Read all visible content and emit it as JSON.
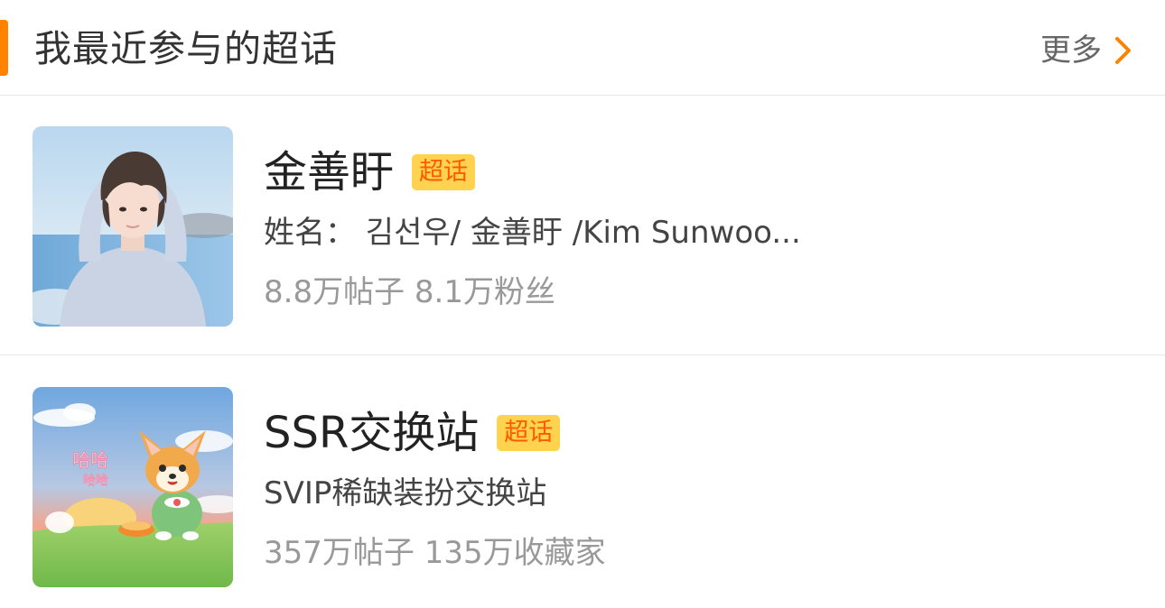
{
  "section": {
    "title": "我最近参与的超话",
    "more_label": "更多",
    "accent_color": "#ff8200"
  },
  "items": [
    {
      "title": "金善盱",
      "badge": "超话",
      "description": "姓名： 김선우/ 金善盱 /Kim Sunwoo...",
      "stats": "8.8万帖子 8.1万粉丝",
      "thumbnail": "person-photo-icon"
    },
    {
      "title": "SSR交换站",
      "badge": "超话",
      "description": "SVIP稀缺装扮交换站",
      "stats": "357万帖子 135万收藏家",
      "thumbnail": "corgi-cartoon-icon",
      "thumbnail_text": "哈哈"
    }
  ],
  "colors": {
    "badge_bg": "#ffd34f",
    "badge_text": "#ff5a00",
    "title_text": "#222222",
    "desc_text": "#444444",
    "stats_text": "#999999"
  }
}
